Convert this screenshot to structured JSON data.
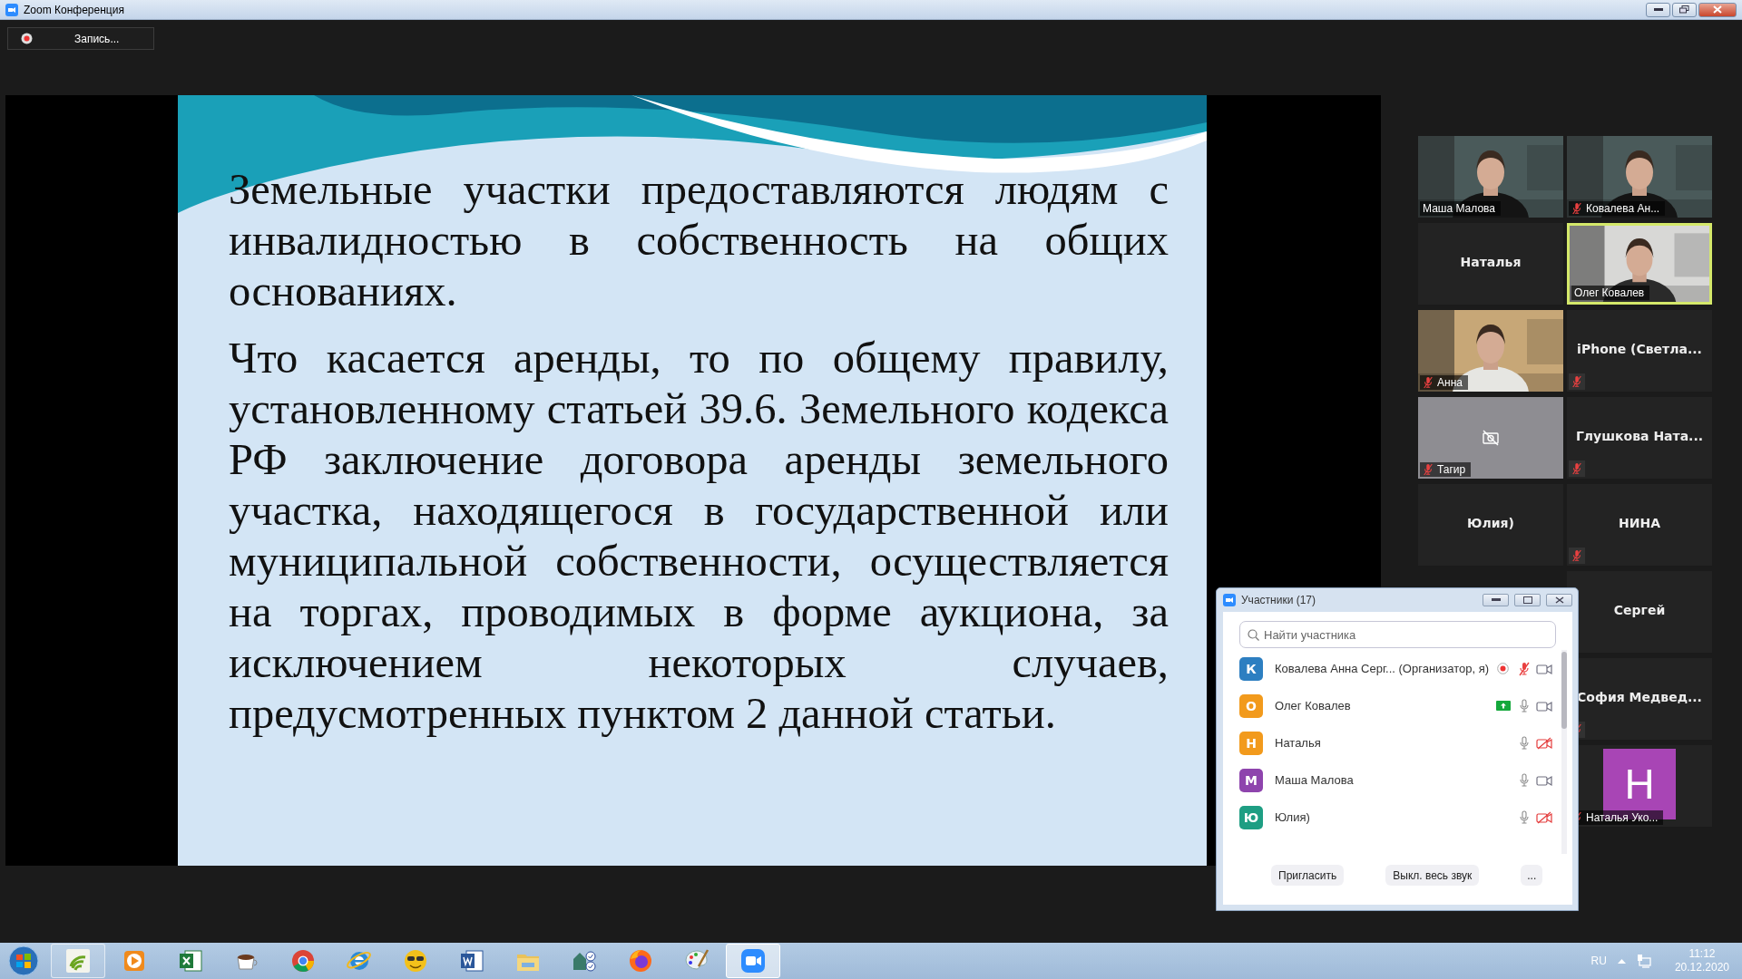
{
  "window": {
    "title": "Zoom Конференция"
  },
  "record_button": {
    "label": "Запись..."
  },
  "slide": {
    "paragraphs": [
      "Земельные участки предоставляются людям с инвалидностью в собственность на общих основаниях.",
      "Что касается аренды, то по общему правилу, установленному статьей 39.6. Земельного кодекса РФ заключение договора аренды земельного участка, находящегося в государственной или муниципальной собственности, осуществляется на торгах, проводимых в форме аукциона, за исключением некоторых случаев, предусмотренных пунктом 2 данной статьи."
    ]
  },
  "gallery": {
    "left_column": [
      {
        "kind": "video",
        "name": "Маша Малова",
        "muted": false,
        "active": false
      },
      {
        "kind": "name",
        "name": "Наталья",
        "muted": false,
        "active": false
      },
      {
        "kind": "video",
        "name": "Анна",
        "muted": true,
        "active": false
      },
      {
        "kind": "camera_off",
        "name": "Тагир",
        "muted": true,
        "active": false
      },
      {
        "kind": "name",
        "name": "Юлия)",
        "muted": false,
        "active": false
      }
    ],
    "right_column": [
      {
        "kind": "video",
        "name": "Ковалева Ан...",
        "muted": true,
        "active": false
      },
      {
        "kind": "video",
        "name": "Олег Ковалев",
        "muted": false,
        "active": true
      },
      {
        "kind": "name",
        "name": "iPhone  (Светла...",
        "muted": true,
        "active": false
      },
      {
        "kind": "name",
        "name": "Глушкова  Ната...",
        "muted": true,
        "active": false
      },
      {
        "kind": "name",
        "name": "НИНА",
        "muted": true,
        "active": false
      },
      {
        "kind": "name",
        "name": "Сергей",
        "muted": false,
        "active": false
      },
      {
        "kind": "name",
        "name": "София  Медвед...",
        "muted": true,
        "active": false
      },
      {
        "kind": "avatar",
        "name": "Наталья Уко...",
        "letter": "Н",
        "color": "#a845b5",
        "muted": true,
        "active": false
      }
    ]
  },
  "participants": {
    "title": "Участники (17)",
    "search": {
      "placeholder": "Найти участника"
    },
    "rows": [
      {
        "letter": "К",
        "color": "#2d7fc1",
        "name": "Ковалева Анна Серг... (Организатор, я)",
        "recording": true,
        "badge": false,
        "muted": true,
        "video_off": false
      },
      {
        "letter": "О",
        "color": "#f29a1c",
        "name": "Олег Ковалев",
        "recording": false,
        "badge": true,
        "muted": false,
        "video_off": false
      },
      {
        "letter": "Н",
        "color": "#f29a1c",
        "name": "Наталья",
        "recording": false,
        "badge": false,
        "muted": false,
        "video_off": true
      },
      {
        "letter": "М",
        "color": "#8e44ad",
        "name": "Маша Малова",
        "recording": false,
        "badge": false,
        "muted": false,
        "video_off": false
      },
      {
        "letter": "Ю",
        "color": "#1e9e83",
        "name": "Юлия)",
        "recording": false,
        "badge": false,
        "muted": false,
        "video_off": true
      }
    ],
    "buttons": [
      "Пригласить",
      "Выкл. весь звук",
      "..."
    ]
  },
  "taskbar": {
    "apps": [
      {
        "kind": "signal",
        "selected": false,
        "open": true
      },
      {
        "kind": "player",
        "selected": false,
        "open": false
      },
      {
        "kind": "sheet",
        "selected": false,
        "open": false
      },
      {
        "kind": "cup",
        "selected": false,
        "open": false
      },
      {
        "kind": "chrome",
        "selected": false,
        "open": false
      },
      {
        "kind": "ie",
        "selected": false,
        "open": false
      },
      {
        "kind": "smiley",
        "selected": false,
        "open": false
      },
      {
        "kind": "word",
        "selected": false,
        "open": false
      },
      {
        "kind": "folder",
        "selected": false,
        "open": false
      },
      {
        "kind": "house",
        "selected": false,
        "open": false
      },
      {
        "kind": "fox",
        "selected": false,
        "open": false
      },
      {
        "kind": "palette",
        "selected": false,
        "open": false
      },
      {
        "kind": "zoom",
        "selected": true,
        "open": true
      }
    ],
    "language": "RU",
    "time": "11:12",
    "date": "20.12.2020"
  }
}
